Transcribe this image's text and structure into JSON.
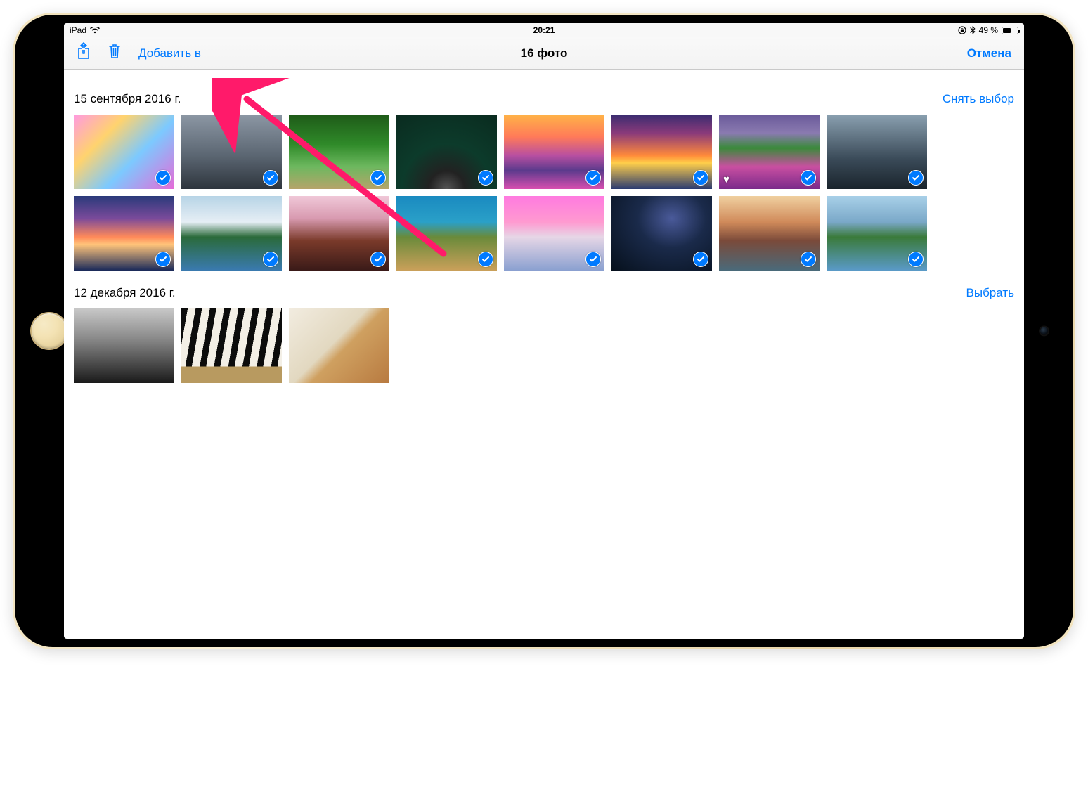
{
  "status_bar": {
    "carrier": "iPad",
    "time": "20:21",
    "battery_text": "49 %",
    "battery_level": 49
  },
  "toolbar": {
    "add_to_label": "Добавить в",
    "title": "16 фото",
    "cancel_label": "Отмена"
  },
  "sections": [
    {
      "title": "15 сентября 2016 г.",
      "action_label": "Снять выбор",
      "photos": [
        {
          "cls": "t1",
          "selected": true,
          "favorite": false
        },
        {
          "cls": "t2",
          "selected": true,
          "favorite": false
        },
        {
          "cls": "t3",
          "selected": true,
          "favorite": false
        },
        {
          "cls": "t4",
          "selected": true,
          "favorite": false
        },
        {
          "cls": "t5",
          "selected": true,
          "favorite": false
        },
        {
          "cls": "t6",
          "selected": true,
          "favorite": false
        },
        {
          "cls": "t7",
          "selected": true,
          "favorite": true
        },
        {
          "cls": "t8",
          "selected": true,
          "favorite": false
        },
        {
          "cls": "t9",
          "selected": true,
          "favorite": false
        },
        {
          "cls": "t10",
          "selected": true,
          "favorite": false
        },
        {
          "cls": "t11",
          "selected": true,
          "favorite": false
        },
        {
          "cls": "t12",
          "selected": true,
          "favorite": false
        },
        {
          "cls": "t13",
          "selected": true,
          "favorite": false
        },
        {
          "cls": "t14",
          "selected": true,
          "favorite": false
        },
        {
          "cls": "t15",
          "selected": true,
          "favorite": false
        },
        {
          "cls": "t16",
          "selected": true,
          "favorite": false
        }
      ]
    },
    {
      "title": "12 декабря 2016 г.",
      "action_label": "Выбрать",
      "photos": [
        {
          "cls": "t17",
          "selected": false,
          "favorite": false
        },
        {
          "cls": "t18",
          "selected": false,
          "favorite": false
        },
        {
          "cls": "t19",
          "selected": false,
          "favorite": false
        }
      ]
    }
  ],
  "icons": {
    "share": "share-icon",
    "trash": "trash-icon",
    "wifi": "wifi-icon",
    "lock": "rotation-lock-icon",
    "bluetooth": "bluetooth-icon"
  },
  "annotation": {
    "target": "add-to-button",
    "color": "#ff1a6a"
  }
}
